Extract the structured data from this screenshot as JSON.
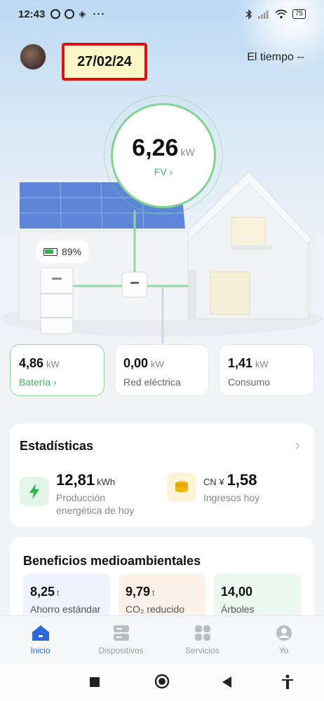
{
  "status_bar": {
    "time": "12:43",
    "battery": "75"
  },
  "header": {
    "date": "27/02/24",
    "weather": "El tiempo --"
  },
  "pv": {
    "value": "6,26",
    "unit": "kW",
    "label": "FV ›"
  },
  "battery_chip": {
    "percent": "89%"
  },
  "cards": [
    {
      "value": "4,86",
      "unit": "kW",
      "label": "Batería ›"
    },
    {
      "value": "0,00",
      "unit": "kW",
      "label": "Red eléctrica"
    },
    {
      "value": "1,41",
      "unit": "kW",
      "label": "Consumo"
    }
  ],
  "stats": {
    "title": "Estadísticas",
    "chevron": "›",
    "production": {
      "value": "12,81",
      "unit": "kWh",
      "label_line1": "Producción",
      "label_line2": "energética de hoy"
    },
    "income": {
      "currency": "CN ¥",
      "value": "1,58",
      "label": "Ingresos hoy"
    }
  },
  "environment": {
    "title": "Beneficios medioambientales",
    "items": [
      {
        "value": "8,25",
        "unit": "t",
        "label": "Ahorro estándar"
      },
      {
        "value": "9,79",
        "unit": "t",
        "label": "CO₂ reducido"
      },
      {
        "value": "14,00",
        "unit": "",
        "label": "Árboles"
      }
    ]
  },
  "tabs": [
    {
      "label": "Inicio",
      "icon": "home-icon"
    },
    {
      "label": "Dispositivos",
      "icon": "devices-icon"
    },
    {
      "label": "Servicios",
      "icon": "grid-icon"
    },
    {
      "label": "Yo",
      "icon": "person-icon"
    }
  ],
  "colors": {
    "accent_green": "#3cb75a",
    "accent_blue": "#2a69d8",
    "date_border": "#e11010"
  }
}
